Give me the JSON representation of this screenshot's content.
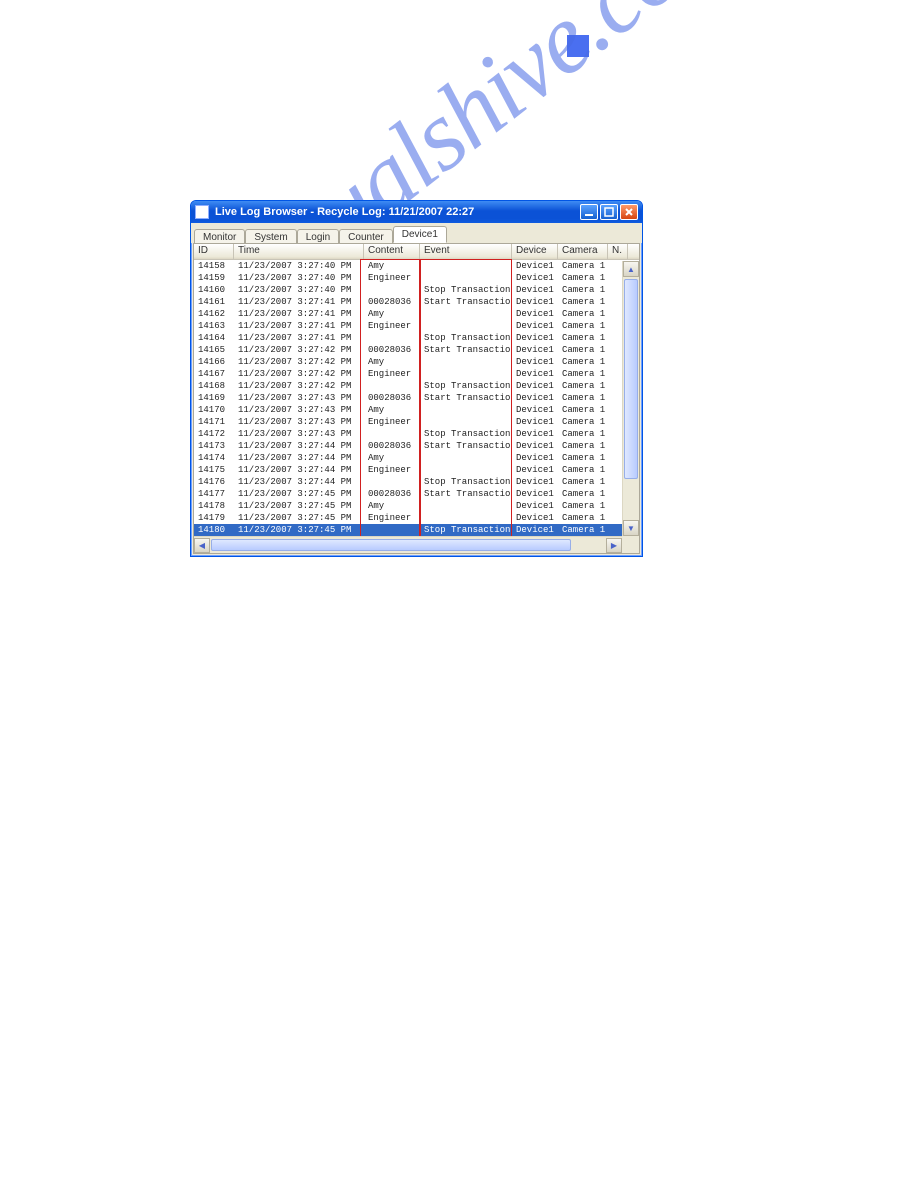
{
  "page_marker_color": "#4a6ff0",
  "watermark_text": "manualshive.com",
  "window": {
    "title": "Live Log Browser   -  Recycle Log: 11/21/2007 22:27",
    "tabs": [
      {
        "label": "Monitor",
        "active": false
      },
      {
        "label": "System",
        "active": false
      },
      {
        "label": "Login",
        "active": false
      },
      {
        "label": "Counter",
        "active": false
      },
      {
        "label": "Device1",
        "active": true
      }
    ],
    "columns": [
      {
        "label": "ID",
        "cls": "col-id"
      },
      {
        "label": "Time",
        "cls": "col-time"
      },
      {
        "label": "Content",
        "cls": "col-content"
      },
      {
        "label": "Event",
        "cls": "col-event"
      },
      {
        "label": "Device",
        "cls": "col-device"
      },
      {
        "label": "Camera",
        "cls": "col-camera"
      },
      {
        "label": "N.",
        "cls": "col-n"
      }
    ],
    "rows": [
      {
        "id": "14158",
        "time": "11/23/2007 3:27:40 PM",
        "content": "Amy",
        "event": "",
        "device": "Device1",
        "camera": "Camera 1",
        "selected": false
      },
      {
        "id": "14159",
        "time": "11/23/2007 3:27:40 PM",
        "content": "Engineer",
        "event": "",
        "device": "Device1",
        "camera": "Camera 1",
        "selected": false
      },
      {
        "id": "14160",
        "time": "11/23/2007 3:27:40 PM",
        "content": "",
        "event": "Stop Transaction",
        "device": "Device1",
        "camera": "Camera 1",
        "selected": false
      },
      {
        "id": "14161",
        "time": "11/23/2007 3:27:41 PM",
        "content": "00028036",
        "event": "Start Transaction",
        "device": "Device1",
        "camera": "Camera 1",
        "selected": false
      },
      {
        "id": "14162",
        "time": "11/23/2007 3:27:41 PM",
        "content": "Amy",
        "event": "",
        "device": "Device1",
        "camera": "Camera 1",
        "selected": false
      },
      {
        "id": "14163",
        "time": "11/23/2007 3:27:41 PM",
        "content": "Engineer",
        "event": "",
        "device": "Device1",
        "camera": "Camera 1",
        "selected": false
      },
      {
        "id": "14164",
        "time": "11/23/2007 3:27:41 PM",
        "content": "",
        "event": "Stop Transaction",
        "device": "Device1",
        "camera": "Camera 1",
        "selected": false
      },
      {
        "id": "14165",
        "time": "11/23/2007 3:27:42 PM",
        "content": "00028036",
        "event": "Start Transaction",
        "device": "Device1",
        "camera": "Camera 1",
        "selected": false
      },
      {
        "id": "14166",
        "time": "11/23/2007 3:27:42 PM",
        "content": "Amy",
        "event": "",
        "device": "Device1",
        "camera": "Camera 1",
        "selected": false
      },
      {
        "id": "14167",
        "time": "11/23/2007 3:27:42 PM",
        "content": "Engineer",
        "event": "",
        "device": "Device1",
        "camera": "Camera 1",
        "selected": false
      },
      {
        "id": "14168",
        "time": "11/23/2007 3:27:42 PM",
        "content": "",
        "event": "Stop Transaction",
        "device": "Device1",
        "camera": "Camera 1",
        "selected": false
      },
      {
        "id": "14169",
        "time": "11/23/2007 3:27:43 PM",
        "content": "00028036",
        "event": "Start Transaction",
        "device": "Device1",
        "camera": "Camera 1",
        "selected": false
      },
      {
        "id": "14170",
        "time": "11/23/2007 3:27:43 PM",
        "content": "Amy",
        "event": "",
        "device": "Device1",
        "camera": "Camera 1",
        "selected": false
      },
      {
        "id": "14171",
        "time": "11/23/2007 3:27:43 PM",
        "content": "Engineer",
        "event": "",
        "device": "Device1",
        "camera": "Camera 1",
        "selected": false
      },
      {
        "id": "14172",
        "time": "11/23/2007 3:27:43 PM",
        "content": "",
        "event": "Stop Transaction",
        "device": "Device1",
        "camera": "Camera 1",
        "selected": false
      },
      {
        "id": "14173",
        "time": "11/23/2007 3:27:44 PM",
        "content": "00028036",
        "event": "Start Transaction",
        "device": "Device1",
        "camera": "Camera 1",
        "selected": false
      },
      {
        "id": "14174",
        "time": "11/23/2007 3:27:44 PM",
        "content": "Amy",
        "event": "",
        "device": "Device1",
        "camera": "Camera 1",
        "selected": false
      },
      {
        "id": "14175",
        "time": "11/23/2007 3:27:44 PM",
        "content": "Engineer",
        "event": "",
        "device": "Device1",
        "camera": "Camera 1",
        "selected": false
      },
      {
        "id": "14176",
        "time": "11/23/2007 3:27:44 PM",
        "content": "",
        "event": "Stop Transaction",
        "device": "Device1",
        "camera": "Camera 1",
        "selected": false
      },
      {
        "id": "14177",
        "time": "11/23/2007 3:27:45 PM",
        "content": "00028036",
        "event": "Start Transaction",
        "device": "Device1",
        "camera": "Camera 1",
        "selected": false
      },
      {
        "id": "14178",
        "time": "11/23/2007 3:27:45 PM",
        "content": "Amy",
        "event": "",
        "device": "Device1",
        "camera": "Camera 1",
        "selected": false
      },
      {
        "id": "14179",
        "time": "11/23/2007 3:27:45 PM",
        "content": "Engineer",
        "event": "",
        "device": "Device1",
        "camera": "Camera 1",
        "selected": false
      },
      {
        "id": "14180",
        "time": "11/23/2007 3:27:45 PM",
        "content": "",
        "event": "Stop Transaction",
        "device": "Device1",
        "camera": "Camera 1",
        "selected": true
      }
    ]
  }
}
